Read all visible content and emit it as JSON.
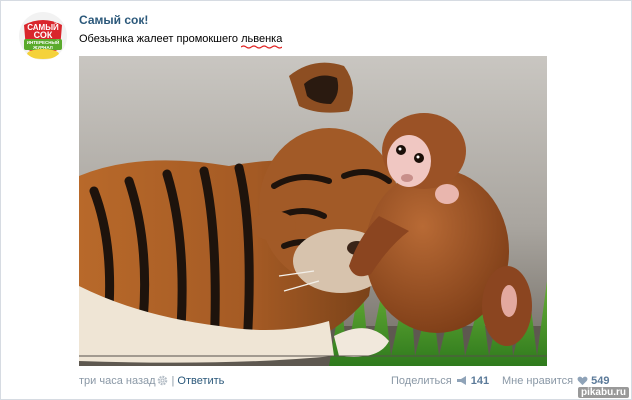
{
  "post": {
    "author": "Самый сок!",
    "text_prefix": "Обезьянка жалеет промокшего ",
    "text_misspelled": "львенка",
    "avatar_logo": {
      "line1": "САМЫЙ",
      "line2": "СОК",
      "line3": "ИНТЕРЕСНЫЙ",
      "line4": "ЖУРНАЛ"
    }
  },
  "footer": {
    "time": "три часа назад",
    "separator": "|",
    "reply": "Ответить",
    "share_label": "Поделиться",
    "share_count": "141",
    "like_label": "Мне нравится",
    "like_count": "549"
  },
  "watermark": "pikabu.ru",
  "colors": {
    "link": "#2b587a",
    "muted": "#8a98a6",
    "count": "#5b7a99",
    "misspell_underline": "#e02020",
    "logo_red": "#d9262c",
    "logo_green": "#5aaa2c"
  }
}
